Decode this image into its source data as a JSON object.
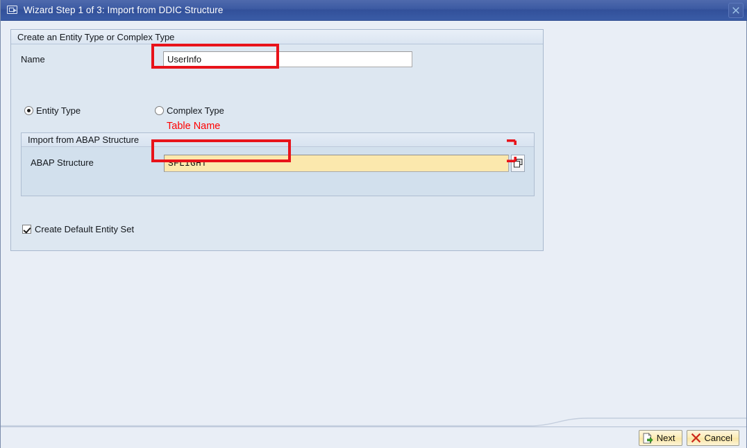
{
  "window": {
    "title": "Wizard Step 1 of 3: Import from DDIC Structure",
    "title_icon": "sap-dialog-icon",
    "close_icon": "close-icon",
    "close_label": "Close"
  },
  "groupbox": {
    "title": "Create an Entity Type or Complex Type",
    "name_field": {
      "label": "Name",
      "value": "UserInfo",
      "placeholder": ""
    },
    "type_radios": [
      {
        "label": "Entity Type",
        "selected": true
      },
      {
        "label": "Complex Type",
        "selected": false
      }
    ],
    "inner_group": {
      "title": "Import from ABAP Structure",
      "abap_field": {
        "label": "ABAP Structure",
        "value": "SFLIGHT",
        "placeholder": "",
        "lookup_icon": "value-help-icon"
      }
    },
    "default_entity_set": {
      "label": "Create Default Entity Set",
      "checked": true
    }
  },
  "footer": {
    "buttons": [
      {
        "label": "Next",
        "icon": "next-document-icon"
      },
      {
        "label": "Cancel",
        "icon": "cancel-x-icon"
      }
    ]
  },
  "annotations": {
    "table_name_note": "Table Name",
    "highlight_color": "#e8131a",
    "note_color": "#ff0000"
  }
}
